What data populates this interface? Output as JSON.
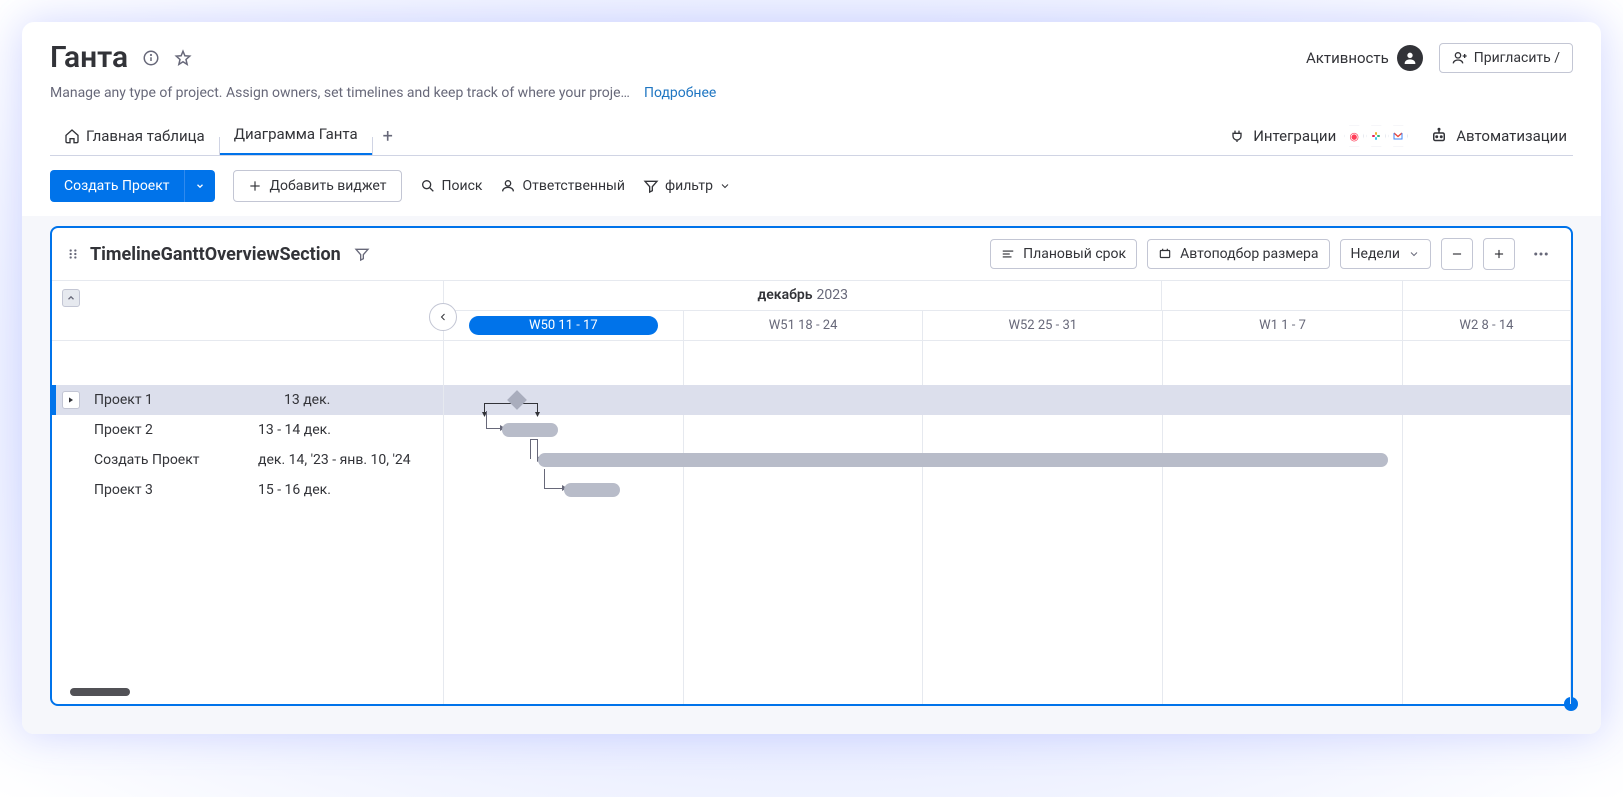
{
  "header": {
    "title": "Ганта",
    "subtitle": "Manage any type of project. Assign owners, set timelines and keep track of where your projec…",
    "more_link": "Подробнее",
    "activity_label": "Активность",
    "invite_label": "Пригласить /"
  },
  "tabs": {
    "main_table": "Главная таблица",
    "gantt": "Диаграмма Ганта",
    "integrations_label": "Интеграции",
    "automations_label": "Автоматизации"
  },
  "toolbar": {
    "create_label": "Создать Проект",
    "add_widget_label": "Добавить виджет",
    "search_label": "Поиск",
    "owner_label": "Ответственный",
    "filter_label": "фильтр"
  },
  "gantt": {
    "title": "TimelineGanttOverviewSection",
    "planned_label": "Плановый срок",
    "autofit_label": "Автоподбор размера",
    "scale_label": "Недели",
    "month_label_bold": "декабрь",
    "month_label_year": "2023",
    "weeks": [
      "W50 11 - 17",
      "W51 18 - 24",
      "W52 25 - 31",
      "W1 1 - 7",
      "W2 8 - 14"
    ],
    "tasks": [
      {
        "name": "Проект 1",
        "date": "13 дек."
      },
      {
        "name": "Проект 2",
        "date": "13 - 14 дек."
      },
      {
        "name": "Создать Проект",
        "date": "дек. 14, '23 - янв. 10, '24"
      },
      {
        "name": "Проект 3",
        "date": "15 - 16 дек."
      }
    ]
  }
}
